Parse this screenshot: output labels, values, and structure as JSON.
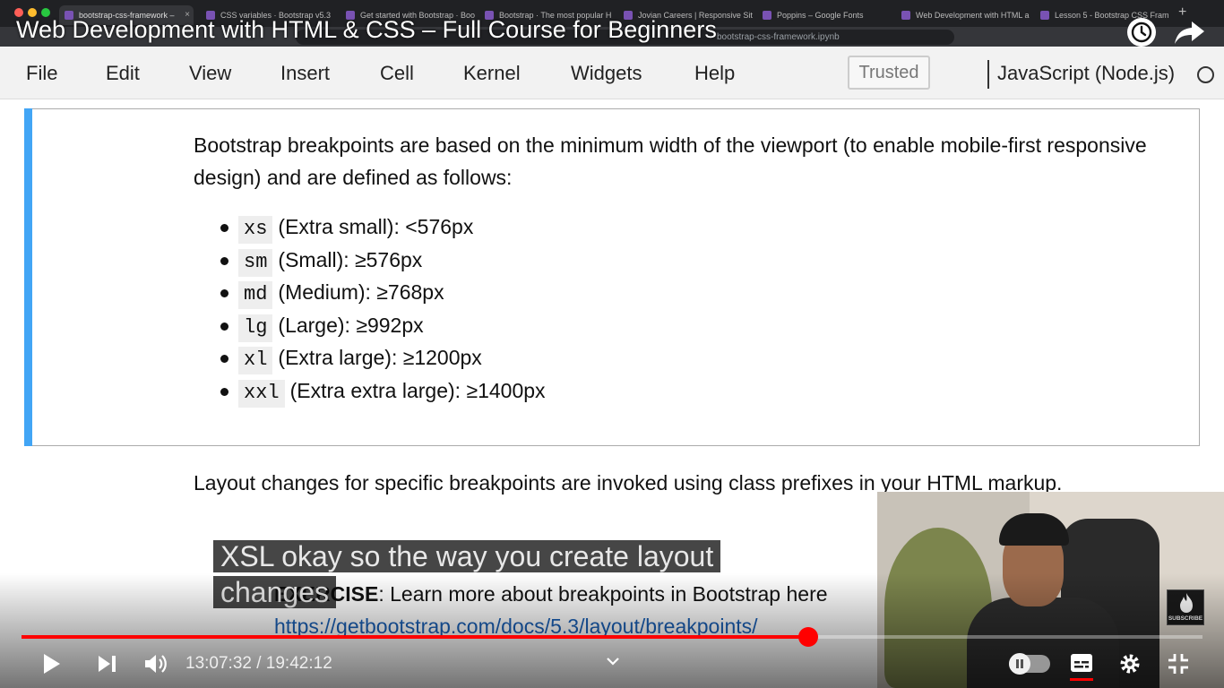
{
  "browser": {
    "tabs": [
      {
        "title": "bootstrap-css-framework –",
        "active": true
      },
      {
        "title": "CSS variables · Bootstrap v5.3"
      },
      {
        "title": "Get started with Bootstrap · Boo"
      },
      {
        "title": "Bootstrap · The most popular H"
      },
      {
        "title": "Jovian Careers | Responsive Site"
      },
      {
        "title": "Poppins – Google Fonts"
      },
      {
        "title": "Web Development with HTML a"
      },
      {
        "title": "Lesson 5 - Bootstrap CSS Fram"
      }
    ],
    "url_fragment": "bootstrap-css-framework.ipynb"
  },
  "video": {
    "title": "Web Development with HTML & CSS – Full Course for Beginners",
    "caption": "XSL okay so the way you create layout changes",
    "current_time": "13:07:32",
    "duration": "19:42:12",
    "time_display": "13:07:32 / 19:42:12",
    "progress_fraction": 0.666,
    "subscribe_label": "SUBSCRIBE"
  },
  "notebook": {
    "menu": [
      "File",
      "Edit",
      "View",
      "Insert",
      "Cell",
      "Kernel",
      "Widgets",
      "Help"
    ],
    "trusted_label": "Trusted",
    "kernel_name": "JavaScript (Node.js)",
    "cell": {
      "intro": "Bootstrap breakpoints are based on the minimum width of the viewport (to enable mobile-first responsive design) and are defined as follows:",
      "breakpoints": [
        {
          "code": "xs",
          "desc": "(Extra small): <576px"
        },
        {
          "code": "sm",
          "desc": "(Small): ≥576px"
        },
        {
          "code": "md",
          "desc": "(Medium): ≥768px"
        },
        {
          "code": "lg",
          "desc": "(Large): ≥992px"
        },
        {
          "code": "xl",
          "desc": "(Extra large): ≥1200px"
        },
        {
          "code": "xxl",
          "desc": "(Extra extra large): ≥1400px"
        }
      ]
    },
    "layout_paragraph": "Layout changes for specific breakpoints are invoked using class prefixes in your HTML markup.",
    "exercise_label": "EXERCISE",
    "exercise_text": ": Learn more about breakpoints in Bootstrap here",
    "exercise_link": "https://getbootstrap.com/docs/5.3/layout/breakpoints/"
  },
  "colors": {
    "cell_accent": "#42a5f5",
    "progress": "#ff0000",
    "link": "#1a5fb4"
  }
}
